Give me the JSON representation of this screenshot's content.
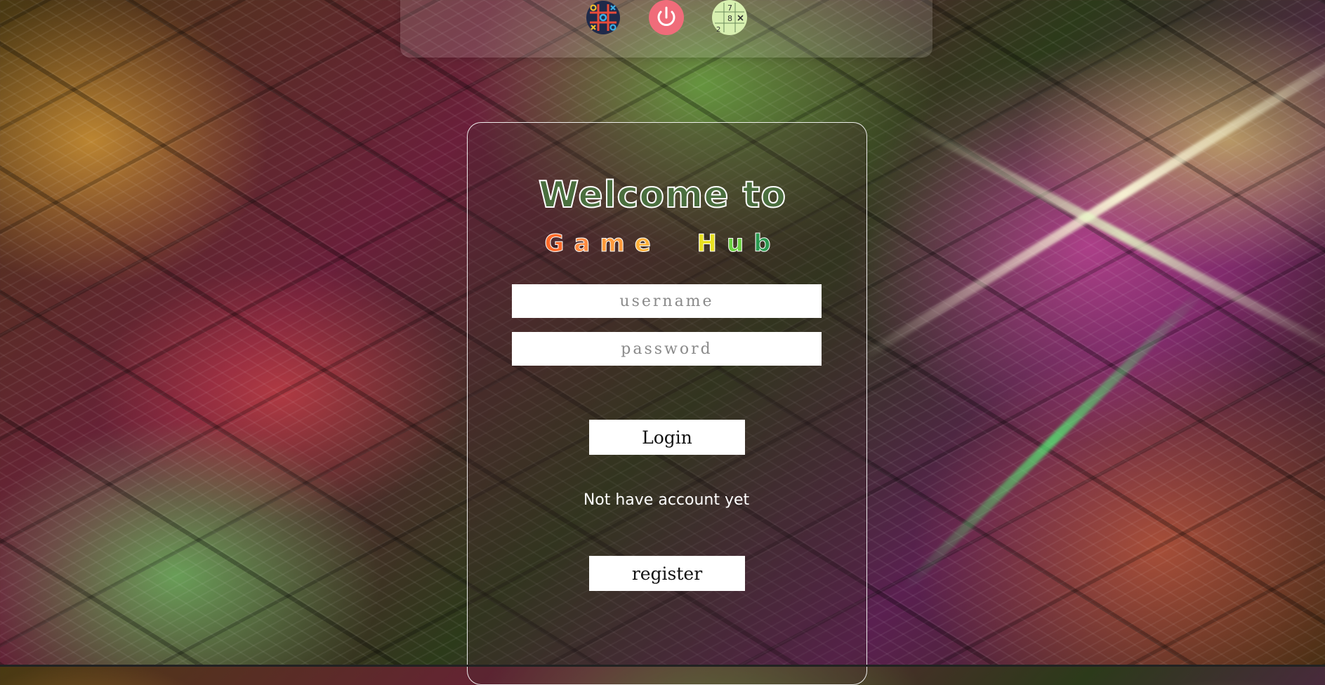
{
  "topbar": {
    "icons": [
      {
        "name": "tic-tac-toe-icon",
        "label": "Tic Tac Toe"
      },
      {
        "name": "power-icon",
        "label": "Power"
      },
      {
        "name": "sudoku-icon",
        "label": "Sudoku"
      }
    ],
    "sudoku_digits": [
      "7",
      "8",
      "2"
    ]
  },
  "login": {
    "welcome_text": "Welcome to",
    "brand_letters": [
      {
        "char": "G",
        "color": "#ff6a2a"
      },
      {
        "char": "a",
        "color": "#ff8a40"
      },
      {
        "char": "m",
        "color": "#ff9a3a"
      },
      {
        "char": "e",
        "color": "#ffb03a"
      },
      {
        "char": " ",
        "color": "#ffffff"
      },
      {
        "char": "H",
        "color": "#e8e020"
      },
      {
        "char": "u",
        "color": "#6ad040"
      },
      {
        "char": "b",
        "color": "#2a9a50"
      }
    ],
    "username_placeholder": "username",
    "password_placeholder": "password",
    "login_label": "Login",
    "note_text": "Not have account yet",
    "register_label": "register"
  },
  "colors": {
    "welcome_fill": "#4a6f3e",
    "power_bg": "#f06c7a",
    "sudoku_bg": "#d8f0b0"
  }
}
